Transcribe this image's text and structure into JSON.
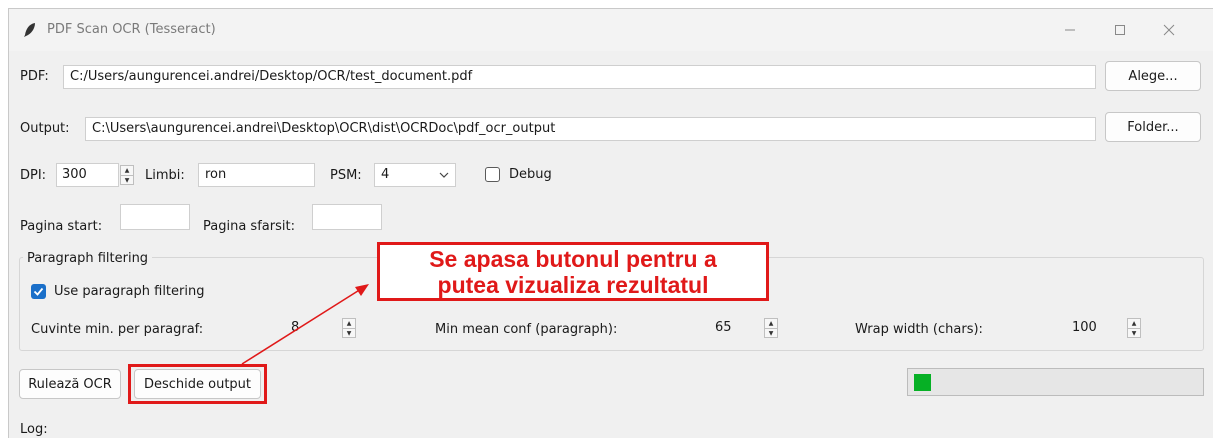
{
  "window": {
    "title": "PDF Scan OCR (Tesseract)",
    "controls": [
      "minimize",
      "maximize",
      "close"
    ]
  },
  "pdf": {
    "label": "PDF:",
    "value": "C:/Users/aungurencei.andrei/Desktop/OCR/test_document.pdf",
    "button": "Alege..."
  },
  "output": {
    "label": "Output:",
    "value": "C:\\Users\\aungurencei.andrei\\Desktop\\OCR\\dist\\OCRDoc\\pdf_ocr_output",
    "button": "Folder..."
  },
  "options": {
    "dpi_label": "DPI:",
    "dpi_value": "300",
    "limbi_label": "Limbi:",
    "limbi_value": "ron",
    "psm_label": "PSM:",
    "psm_value": "4",
    "debug_label": "Debug",
    "debug_checked": false
  },
  "pages": {
    "start_label": "Pagina start:",
    "start_value": "",
    "end_label": "Pagina sfarsit:",
    "end_value": ""
  },
  "paragraph_filtering": {
    "group_title": "Paragraph filtering",
    "use_label": "Use paragraph filtering",
    "use_checked": true,
    "min_words_label": "Cuvinte min. per paragraf:",
    "min_words_value": "8",
    "min_conf_label": "Min mean conf (paragraph):",
    "min_conf_value": "65",
    "wrap_label": "Wrap width (chars):",
    "wrap_value": "100"
  },
  "actions": {
    "run_button": "Rulează OCR",
    "open_button": "Deschide output"
  },
  "progress": {
    "value": 0.06
  },
  "log": {
    "label": "Log:"
  },
  "annotation": {
    "line1": "Se apasa butonul pentru a",
    "line2": "putea vizualiza rezultatul",
    "color": "#e01919"
  },
  "colors": {
    "accent": "#1a6fc9",
    "progress": "#06b025",
    "annotation": "#e01919"
  }
}
